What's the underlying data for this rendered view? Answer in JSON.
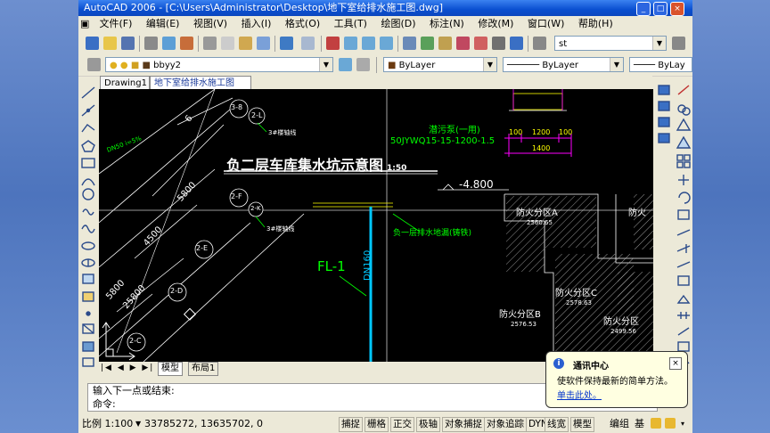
{
  "window": {
    "title": "AutoCAD 2006 - [C:\\Users\\Administrator\\Desktop\\地下室给排水施工图.dwg]",
    "controls": [
      "_",
      "□",
      "×"
    ]
  },
  "menu": [
    "文件(F)",
    "编辑(E)",
    "视图(V)",
    "插入(I)",
    "格式(O)",
    "工具(T)",
    "绘图(D)",
    "标注(N)",
    "修改(M)",
    "窗口(W)",
    "帮助(H)"
  ],
  "toolbar": {
    "text_style": "st",
    "layer_name": "bbyy2",
    "color": "ByLayer",
    "linetype": "ByLayer",
    "lineweight": "ByLay"
  },
  "tabs": [
    "Drawing1",
    "地下室给排水施工图"
  ],
  "drawing": {
    "title": "负二层车库集水坑示意图",
    "scale": "1:50",
    "pump_label": "潜污泵(一用)",
    "pump_model": "50JYWQ15-15-1200-1.5",
    "elevation": "-4.800",
    "pipe_label": "FL-1",
    "pipe_size": "DN160",
    "floor_drain_label": "负一层排水地漏(铸铁)",
    "dims": [
      "100",
      "1200",
      "100",
      "1400",
      "5800",
      "4500",
      "5800",
      "25800",
      "6"
    ],
    "axes": [
      "3-8",
      "2-L",
      "2-F",
      "2-E",
      "2-K",
      "2-D",
      "2-C"
    ],
    "axis_notes": [
      "3#楼轴线",
      "3#楼轴线",
      "3#楼轴线"
    ],
    "zones": [
      {
        "name": "防火分区A",
        "value": "2560.65"
      },
      {
        "name": "防火分区C",
        "value": "2578.63"
      },
      {
        "name": "防火分区B",
        "value": "2576.53"
      },
      {
        "name": "防火分区",
        "value": "2499.56"
      },
      {
        "name": "防火",
        "value": ""
      }
    ],
    "slope_label": "DN50  i=5%"
  },
  "layout_tabs": [
    "模型",
    "布局1"
  ],
  "command": {
    "line1": "输入下一点或结束:",
    "line2": "命令:"
  },
  "status": {
    "scale": "比例 1:100",
    "coords": "33785272, 13635702, 0",
    "buttons": [
      "捕捉",
      "栅格",
      "正交",
      "极轴",
      "对象捕捉",
      "对象追踪",
      "DYN",
      "线宽",
      "模型"
    ],
    "right": [
      "编组",
      "基"
    ]
  },
  "notification": {
    "title": "通讯中心",
    "body": "使软件保持最新的简单方法。",
    "link": "单击此处。"
  },
  "colors": {
    "canvas": "#000000",
    "cad_white": "#ffffff",
    "cad_green": "#00ff00",
    "cad_yellow": "#ffff00",
    "cad_magenta": "#ff00ff",
    "cad_cyan": "#00c8ff",
    "titlebar": "#0a4fd0"
  }
}
